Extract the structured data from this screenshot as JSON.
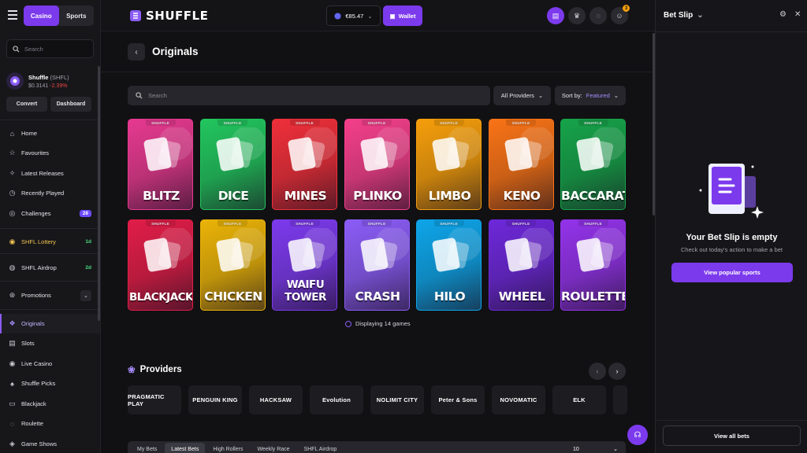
{
  "app": {
    "brand": "SHUFFLE"
  },
  "sidebar": {
    "mode_tabs": [
      "Casino",
      "Sports"
    ],
    "search_placeholder": "Search",
    "token": {
      "name": "Shuffle",
      "ticker": "(SHFL)",
      "price": "$0.3141",
      "change": "-2.39%",
      "convert": "Convert",
      "dashboard": "Dashboard"
    },
    "nav": [
      {
        "label": "Home",
        "icon": "home-icon"
      },
      {
        "label": "Favourites",
        "icon": "star-icon"
      },
      {
        "label": "Latest Releases",
        "icon": "sparkle-icon"
      },
      {
        "label": "Recently Played",
        "icon": "clock-icon"
      },
      {
        "label": "Challenges",
        "icon": "target-icon",
        "badge": "28"
      }
    ],
    "promo_items": [
      {
        "label": "SHFL Lottery",
        "badge": "1d"
      },
      {
        "label": "SHFL Airdrop",
        "badge": "2d"
      }
    ],
    "promotions": "Promotions",
    "categories": [
      "Originals",
      "Slots",
      "Live Casino",
      "Shuffle Picks",
      "Blackjack",
      "Roulette",
      "Game Shows"
    ]
  },
  "topbar": {
    "balance": "€85.47",
    "wallet": "Wallet",
    "notification_count": "3"
  },
  "main": {
    "title": "Originals",
    "search_placeholder": "Search",
    "providers_dropdown": "All Providers",
    "sort_label": "Sort by:",
    "sort_value": "Featured",
    "games_tag": "SHUFFLE",
    "games": [
      {
        "name": "BLITZ",
        "color": "#e6398f"
      },
      {
        "name": "DICE",
        "color": "#22c55e"
      },
      {
        "name": "MINES",
        "color": "#ef2f3a"
      },
      {
        "name": "PLINKO",
        "color": "#f43f8b"
      },
      {
        "name": "LIMBO",
        "color": "#f59e0b"
      },
      {
        "name": "KENO",
        "color": "#f97316"
      },
      {
        "name": "BACCARAT",
        "color": "#16a34a"
      },
      {
        "name": "BLACKJACK",
        "color": "#e11d48"
      },
      {
        "name": "CHICKEN",
        "color": "#eab308"
      },
      {
        "name": "WAIFU TOWER",
        "color": "#7c3aed"
      },
      {
        "name": "CRASH",
        "color": "#8b5cf6"
      },
      {
        "name": "HILO",
        "color": "#0ea5e9"
      },
      {
        "name": "WHEEL",
        "color": "#6d28d9"
      },
      {
        "name": "ROULETTE",
        "color": "#9333ea"
      }
    ],
    "displaying": "Displaying 14 games",
    "providers_title": "Providers",
    "providers": [
      "PRAGMATIC PLAY",
      "PENGUIN KING",
      "HACKSAW",
      "Evolution",
      "NOLIMIT CITY",
      "Peter & Sons",
      "NOVOMATIC",
      "ELK"
    ],
    "bet_tabs": [
      "My Bets",
      "Latest Bets",
      "High Rollers",
      "Weekly Race",
      "SHFL Airdrop"
    ],
    "rows_value": "10"
  },
  "betslip": {
    "title": "Bet Slip",
    "empty_title": "Your Bet Slip is empty",
    "empty_sub": "Check out today's action to make a bet",
    "popular_button": "View popular sports",
    "view_all": "View all bets"
  }
}
